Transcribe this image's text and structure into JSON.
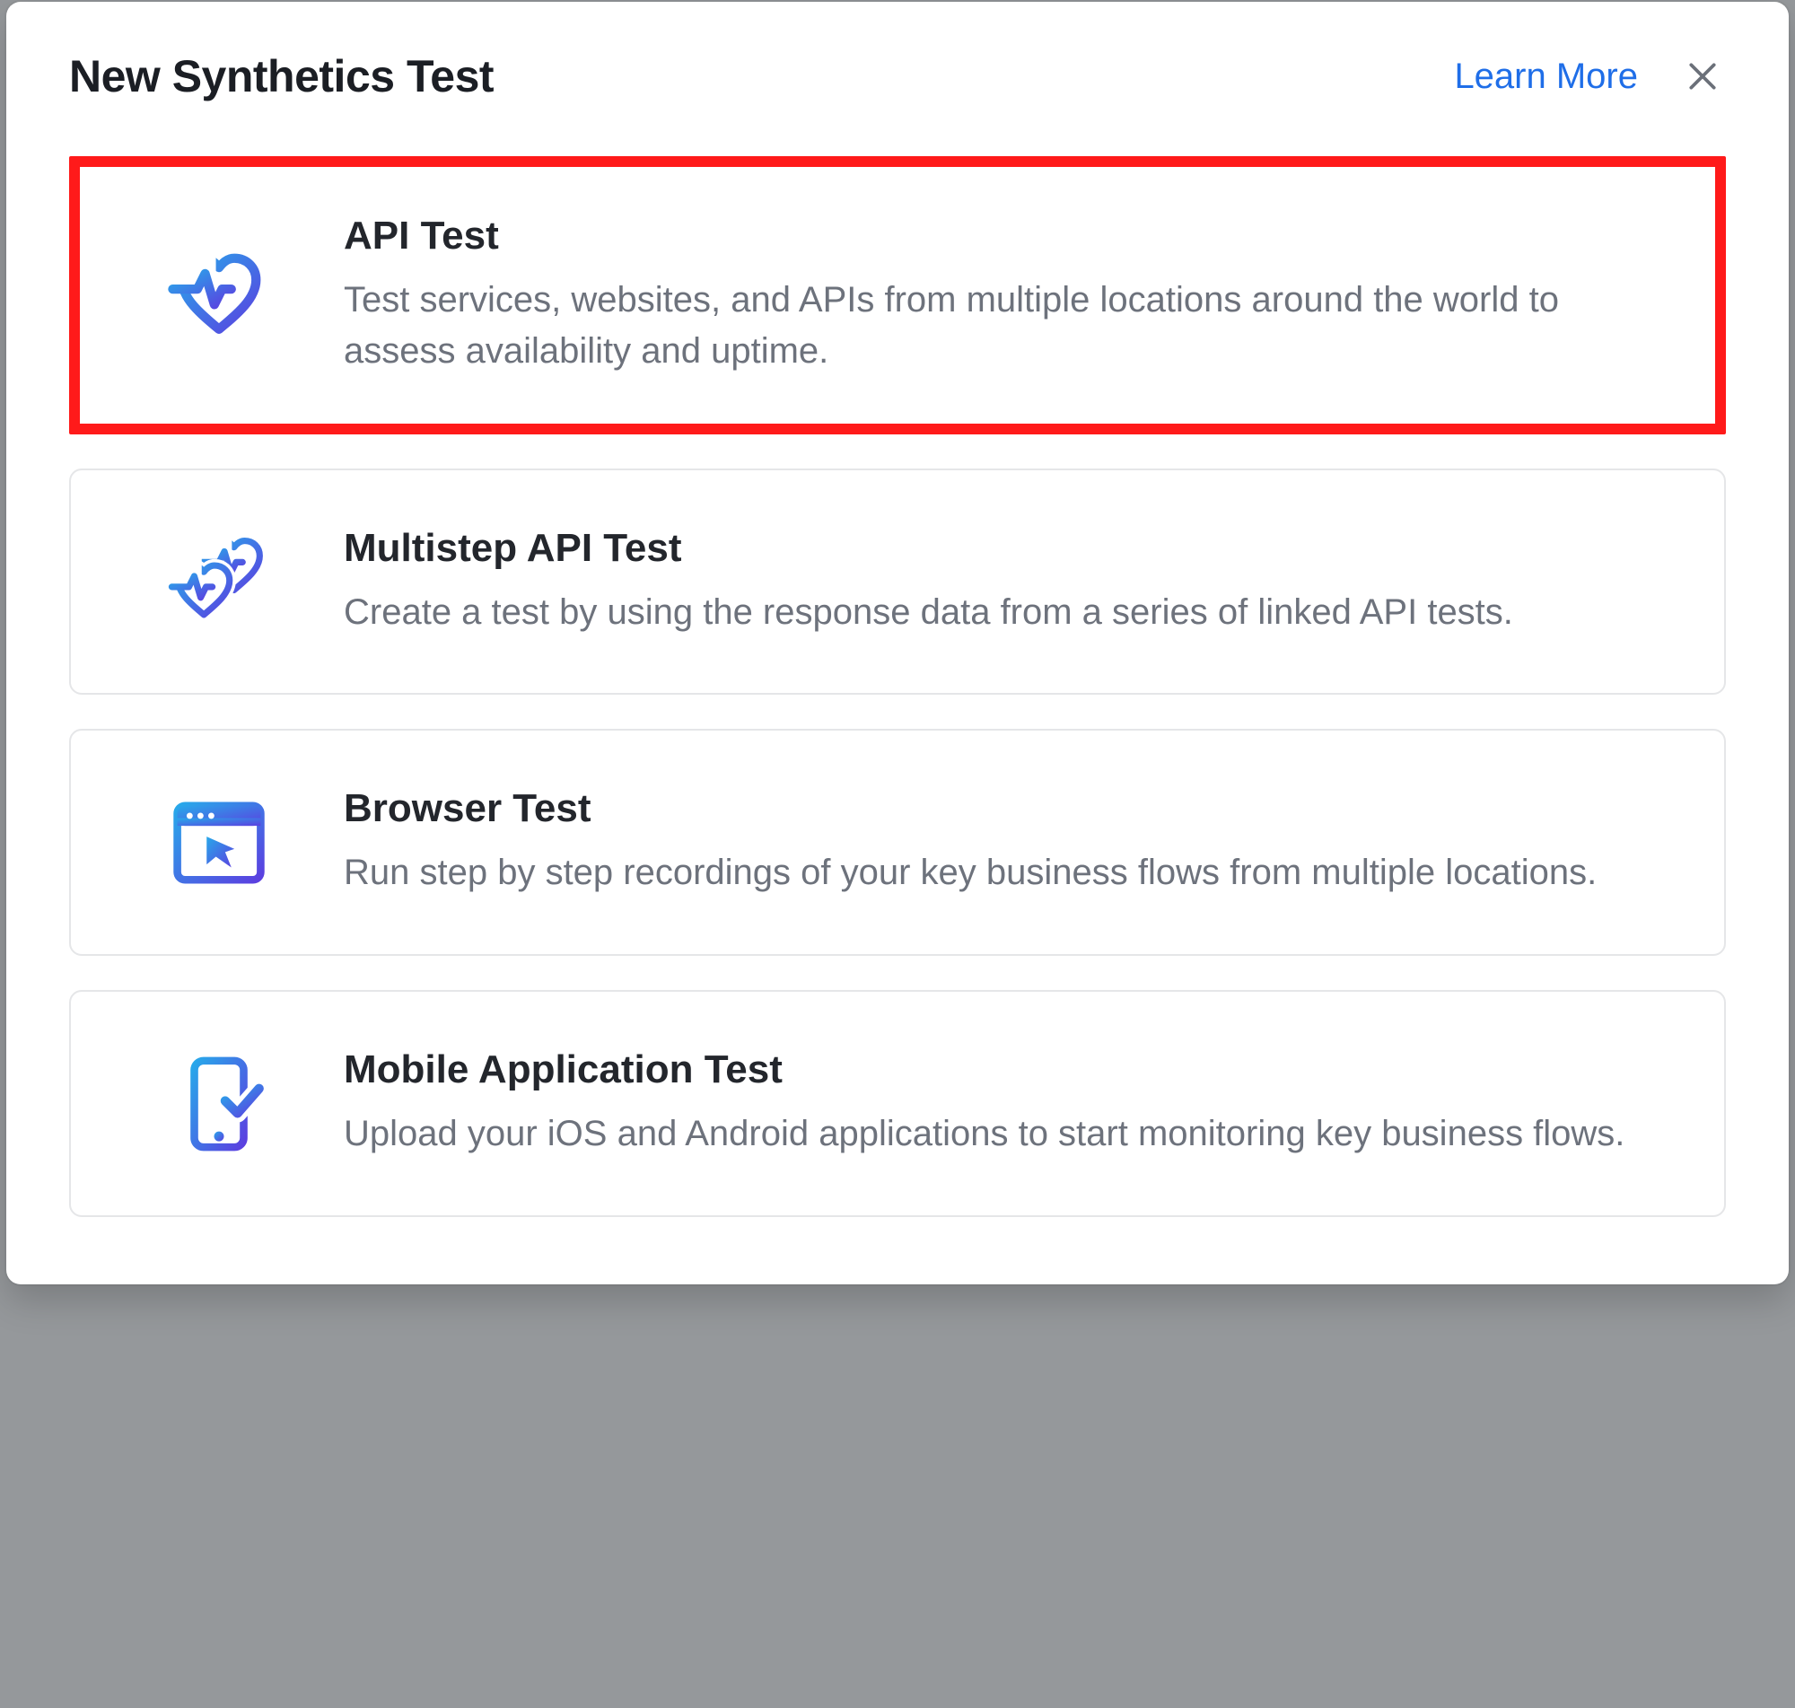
{
  "header": {
    "title": "New Synthetics Test",
    "learn_more": "Learn More"
  },
  "options": [
    {
      "id": "api-test",
      "title": "API Test",
      "description": "Test services, websites, and APIs from multiple locations around the world to assess availability and uptime.",
      "highlighted": true
    },
    {
      "id": "multistep-api-test",
      "title": "Multistep API Test",
      "description": "Create a test by using the response data from a series of linked API tests.",
      "highlighted": false
    },
    {
      "id": "browser-test",
      "title": "Browser Test",
      "description": "Run step by step recordings of your key business flows from multiple locations.",
      "highlighted": false
    },
    {
      "id": "mobile-app-test",
      "title": "Mobile Application Test",
      "description": "Upload your iOS and Android applications to start monitoring key business flows.",
      "highlighted": false
    }
  ]
}
